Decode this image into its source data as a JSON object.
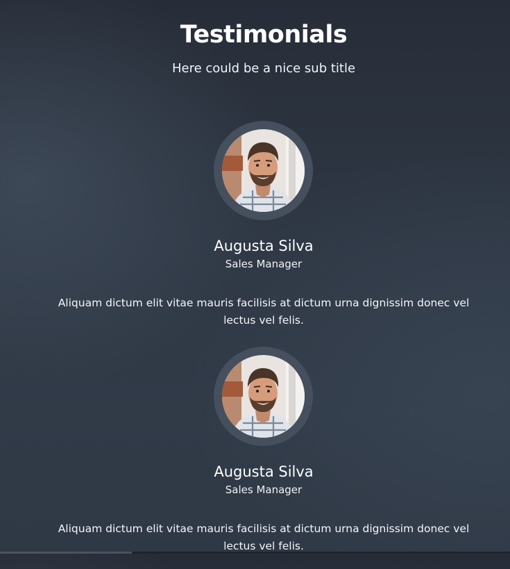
{
  "section": {
    "title": "Testimonials",
    "subtitle": "Here could be a nice sub title"
  },
  "testimonials": [
    {
      "name": "Augusta Silva",
      "role": "Sales Manager",
      "quote": "Aliquam dictum elit vitae mauris facilisis at dictum urna dignissim donec vel lectus vel felis.",
      "avatar_icon": "person-photo"
    },
    {
      "name": "Augusta Silva",
      "role": "Sales Manager",
      "quote": "Aliquam dictum elit vitae mauris facilisis at dictum urna dignissim donec vel lectus vel felis.",
      "avatar_icon": "person-photo"
    }
  ],
  "colors": {
    "background": "#2f3845",
    "avatar_ring": "#454f5d",
    "text": "#ffffff"
  }
}
